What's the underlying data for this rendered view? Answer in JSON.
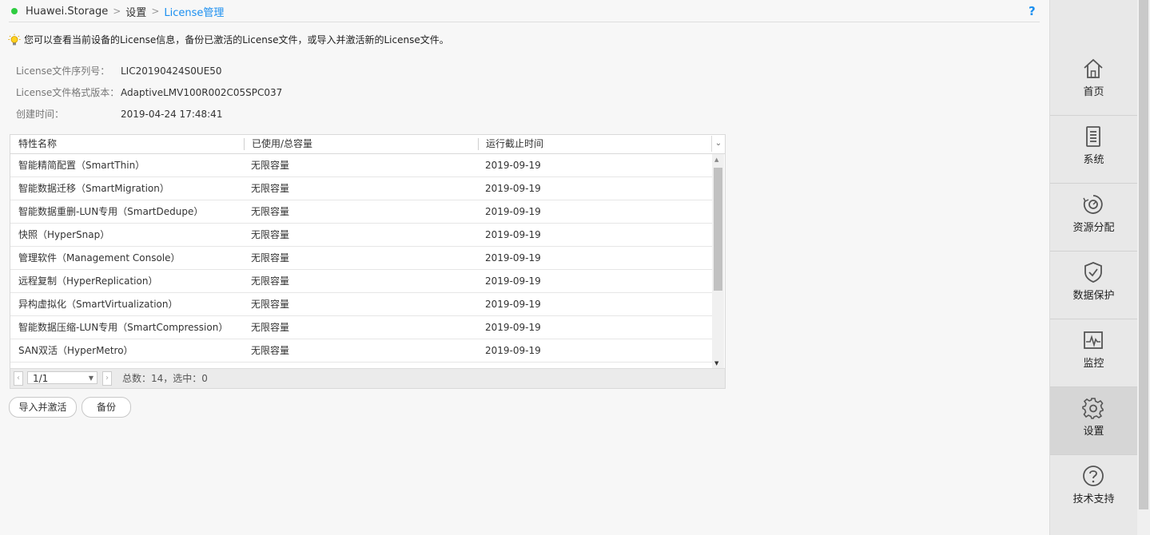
{
  "breadcrumb": {
    "device": "Huawei.Storage",
    "settings": "设置",
    "current": "License管理",
    "help": "?"
  },
  "tip": "您可以查看当前设备的License信息，备份已激活的License文件，或导入并激活新的License文件。",
  "info": [
    {
      "label": "License文件序列号：",
      "value": "LIC20190424S0UE50"
    },
    {
      "label": "License文件格式版本：",
      "value": "AdaptiveLMV100R002C05SPC037"
    },
    {
      "label": "创建时间：",
      "value": "2019-04-24 17:48:41"
    }
  ],
  "table": {
    "headers": [
      "特性名称",
      "已使用/总容量",
      "运行截止时间"
    ],
    "rows": [
      [
        "智能精简配置（SmartThin）",
        "无限容量",
        "2019-09-19"
      ],
      [
        "智能数据迁移（SmartMigration）",
        "无限容量",
        "2019-09-19"
      ],
      [
        "智能数据重删-LUN专用（SmartDedupe）",
        "无限容量",
        "2019-09-19"
      ],
      [
        "快照（HyperSnap）",
        "无限容量",
        "2019-09-19"
      ],
      [
        "管理软件（Management Console）",
        "无限容量",
        "2019-09-19"
      ],
      [
        "远程复制（HyperReplication）",
        "无限容量",
        "2019-09-19"
      ],
      [
        "异构虚拟化（SmartVirtualization）",
        "无限容量",
        "2019-09-19"
      ],
      [
        "智能数据压缩-LUN专用（SmartCompression）",
        "无限容量",
        "2019-09-19"
      ],
      [
        "SAN双活（HyperMetro）",
        "无限容量",
        "2019-09-19"
      ],
      [
        "",
        "",
        ""
      ]
    ],
    "pager": {
      "page": "1/1",
      "total": "总数：14，选中：0"
    }
  },
  "buttons": {
    "import": "导入并激活",
    "backup": "备份"
  },
  "sidebar": [
    {
      "label": "首页",
      "icon": "home-icon"
    },
    {
      "label": "系统",
      "icon": "system-icon"
    },
    {
      "label": "资源分配",
      "icon": "resource-icon"
    },
    {
      "label": "数据保护",
      "icon": "shield-icon"
    },
    {
      "label": "监控",
      "icon": "monitor-icon"
    },
    {
      "label": "设置",
      "icon": "gear-icon",
      "active": true
    },
    {
      "label": "技术支持",
      "icon": "question-icon"
    }
  ],
  "colors": {
    "accent": "#1b8ff0",
    "status_ok": "#2ecc40"
  }
}
